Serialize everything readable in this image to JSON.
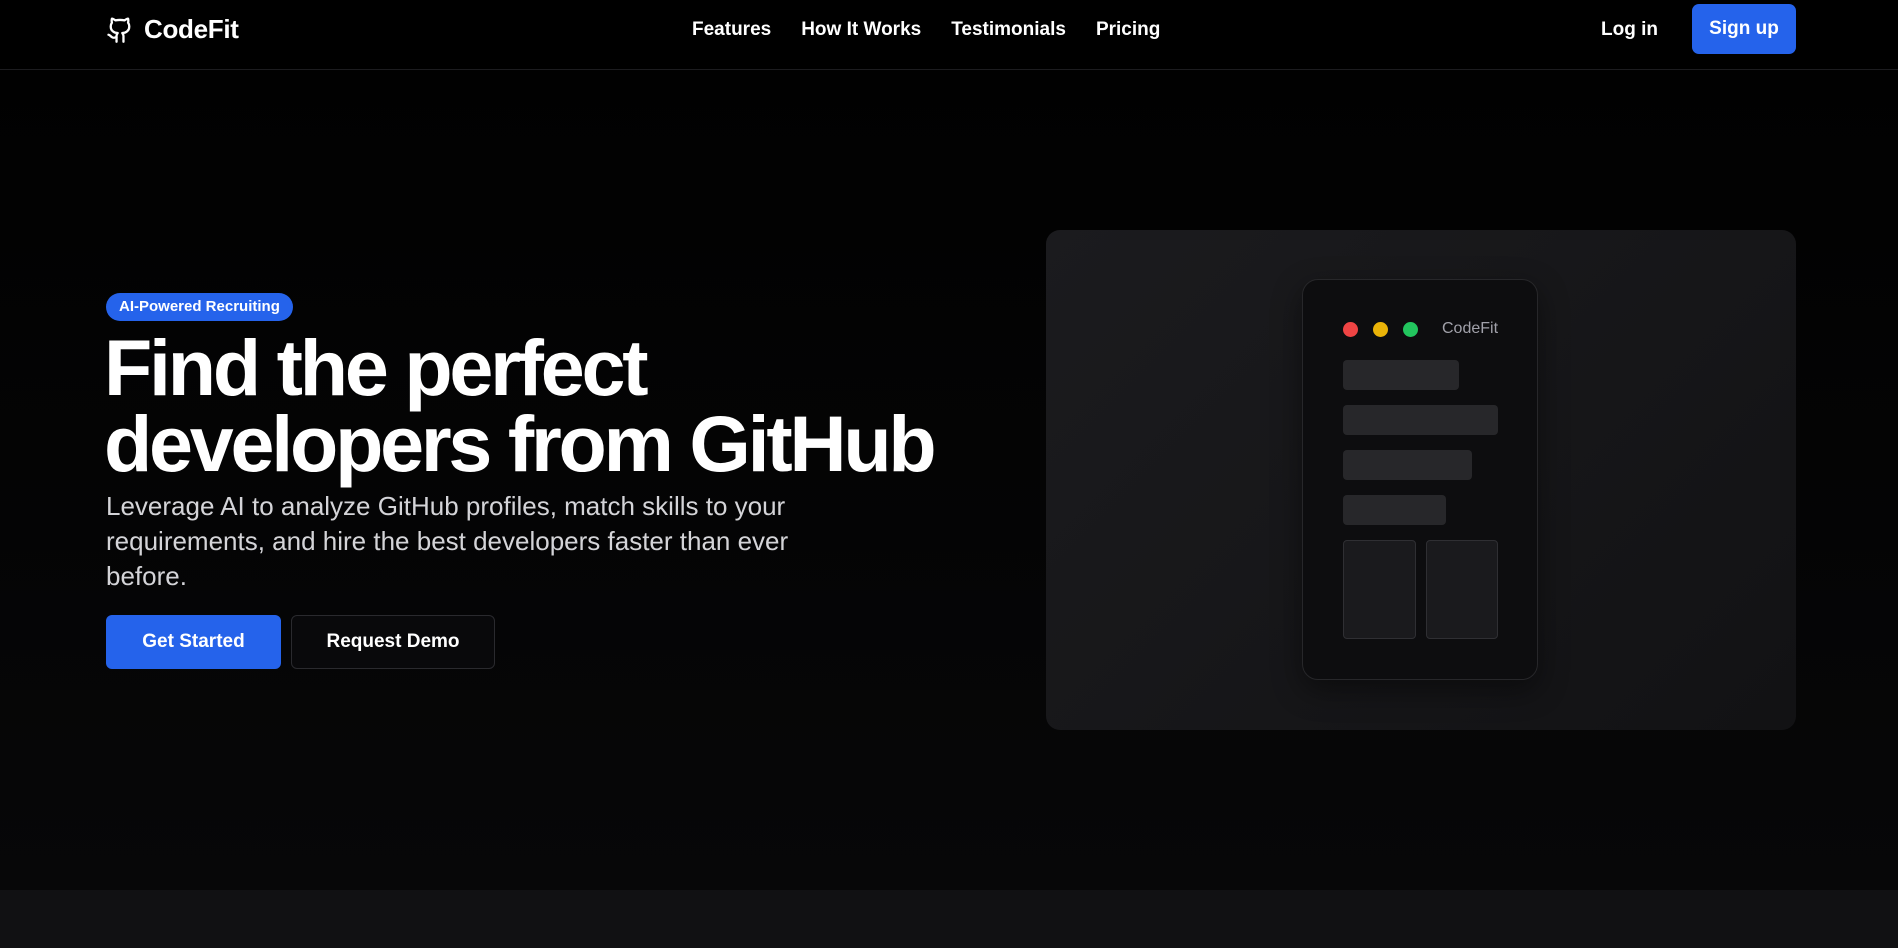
{
  "header": {
    "brand": "CodeFit",
    "logo_icon": "github-icon",
    "nav": [
      {
        "label": "Features"
      },
      {
        "label": "How It Works"
      },
      {
        "label": "Testimonials"
      },
      {
        "label": "Pricing"
      }
    ],
    "login_label": "Log in",
    "signup_label": "Sign up"
  },
  "hero": {
    "badge": "AI-Powered Recruiting",
    "headline_line1": "Find the perfect",
    "headline_line2": "developers from GitHub",
    "subtext": "Leverage AI to analyze GitHub profiles, match skills to your requirements, and hire the best developers faster than ever before.",
    "primary_cta": "Get Started",
    "secondary_cta": "Request Demo"
  },
  "preview": {
    "app_title": "CodeFit",
    "window_dots": [
      "#ef4444",
      "#eab308",
      "#22c55e"
    ]
  },
  "colors": {
    "accent": "#2563eb",
    "background": "#000000"
  }
}
